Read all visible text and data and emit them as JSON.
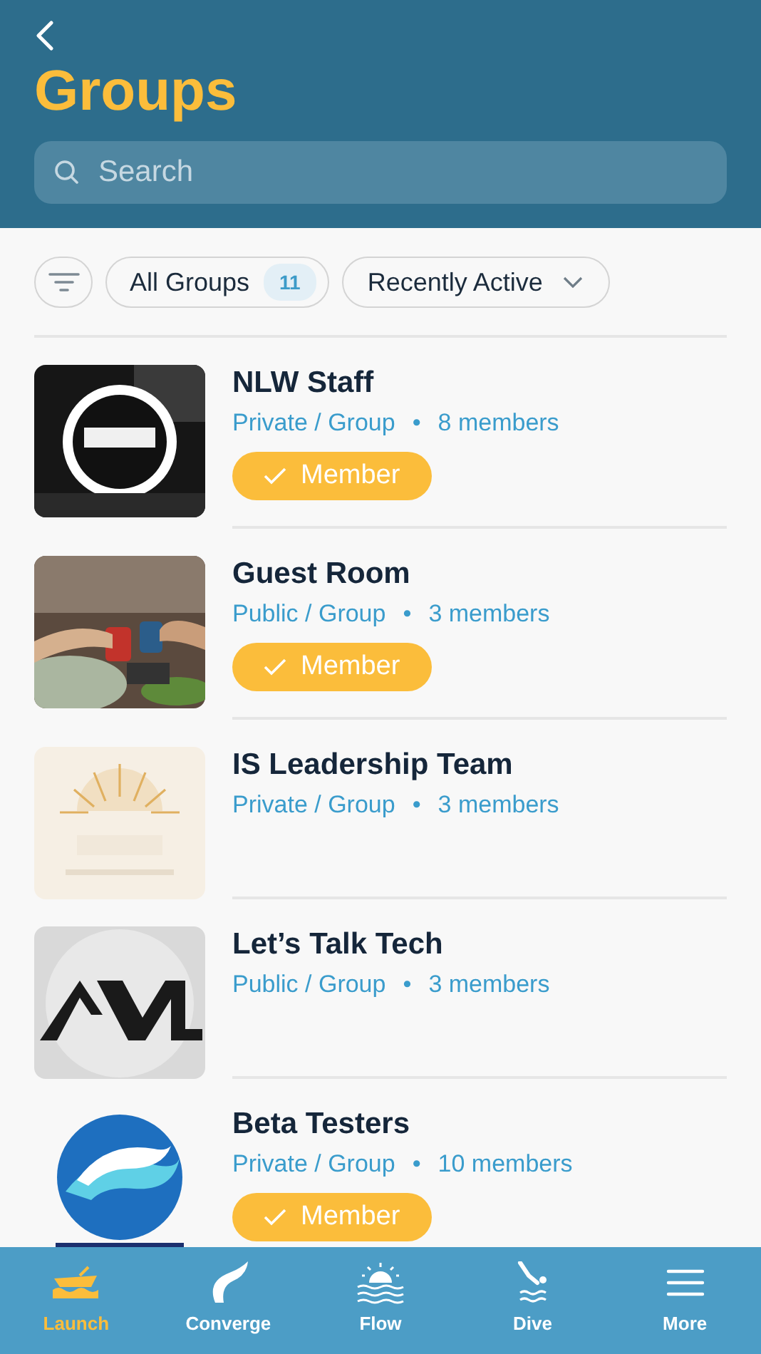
{
  "header": {
    "title": "Groups",
    "search": {
      "placeholder": "Search"
    }
  },
  "filters": {
    "all": {
      "label": "All Groups",
      "count": "11"
    },
    "sort": {
      "label": "Recently Active"
    }
  },
  "groups": [
    {
      "name": "NLW Staff",
      "access": "Private / Group",
      "separator": "•",
      "members": "8 members",
      "badge": "Member"
    },
    {
      "name": "Guest Room",
      "access": "Public / Group",
      "separator": "•",
      "members": "3 members",
      "badge": "Member"
    },
    {
      "name": "IS Leadership Team",
      "access": "Private / Group",
      "separator": "•",
      "members": "3 members"
    },
    {
      "name": "Let’s Talk Tech",
      "access": "Public / Group",
      "separator": "•",
      "members": "3 members"
    },
    {
      "name": "Beta Testers",
      "access": "Private / Group",
      "separator": "•",
      "members": "10 members",
      "badge": "Member"
    }
  ],
  "tab_bar": [
    {
      "label": "Launch",
      "selected": true
    },
    {
      "label": "Converge",
      "selected": false
    },
    {
      "label": "Flow",
      "selected": false
    },
    {
      "label": "Dive",
      "selected": false
    },
    {
      "label": "More",
      "selected": false
    }
  ]
}
